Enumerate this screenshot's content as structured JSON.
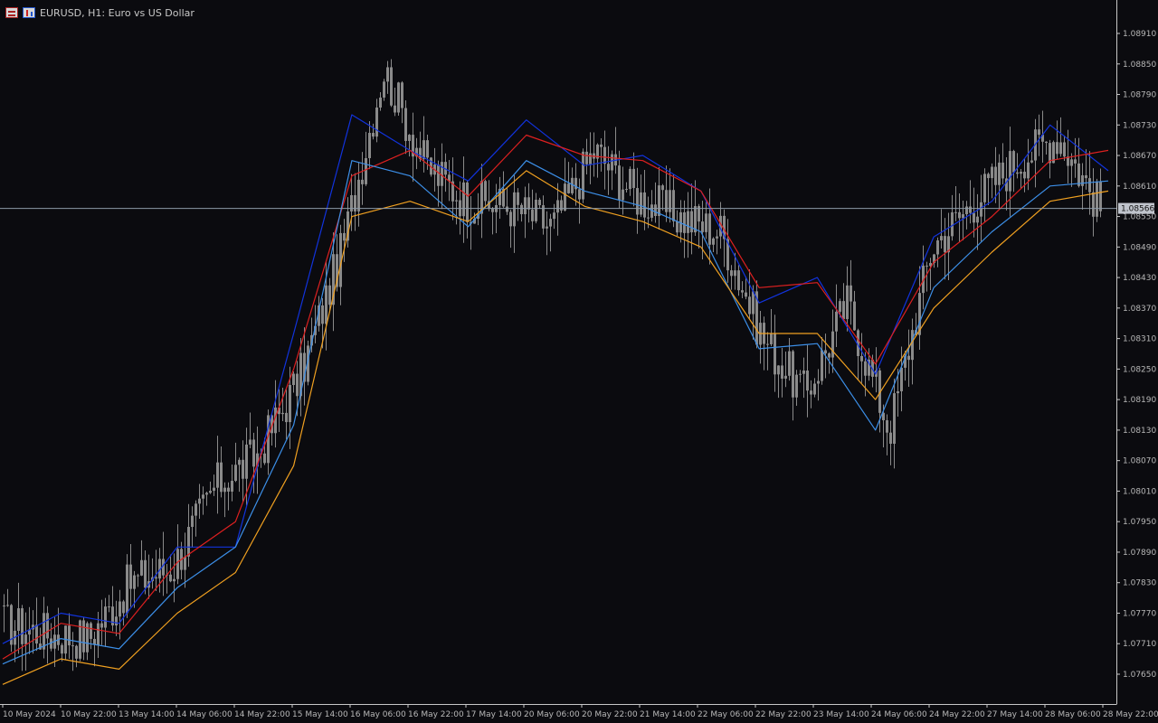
{
  "header": {
    "title": "EURUSD, H1:  Euro vs US Dollar",
    "icons": [
      "chart-list-icon",
      "one-click-trading-icon"
    ]
  },
  "colors": {
    "background": "#0b0b0f",
    "axis": "#c8c8c8",
    "candle": "#8a8a8a",
    "bid_line": "#8d9aa8",
    "ma_blue": "#1133dd",
    "ma_red": "#dd2020",
    "ma_lightblue": "#3c8fe8",
    "ma_orange": "#f0a020"
  },
  "price_axis": {
    "labels": [
      "1.08910",
      "1.08850",
      "1.08790",
      "1.08730",
      "1.08670",
      "1.08610",
      "1.08550",
      "1.08490",
      "1.08430",
      "1.08370",
      "1.08310",
      "1.08250",
      "1.08190",
      "1.08130",
      "1.08070",
      "1.08010",
      "1.07950",
      "1.07890",
      "1.07830",
      "1.07770",
      "1.07710",
      "1.07650"
    ],
    "current_bid": "1.08566"
  },
  "time_axis": {
    "labels": [
      "10 May 2024",
      "10 May 22:00",
      "13 May 14:00",
      "14 May 06:00",
      "14 May 22:00",
      "15 May 14:00",
      "16 May 06:00",
      "16 May 22:00",
      "17 May 14:00",
      "20 May 06:00",
      "20 May 22:00",
      "21 May 14:00",
      "22 May 06:00",
      "22 May 22:00",
      "23 May 14:00",
      "24 May 06:00",
      "24 May 22:00",
      "27 May 14:00",
      "28 May 06:00",
      "28 May 22:00"
    ]
  },
  "chart_data": {
    "type": "line",
    "symbol": "EURUSD",
    "timeframe": "H1",
    "ylim": [
      1.0761,
      1.0895
    ],
    "price_ticks": [
      1.0891,
      1.0885,
      1.0879,
      1.0873,
      1.0867,
      1.0861,
      1.0855,
      1.0849,
      1.0843,
      1.0837,
      1.0831,
      1.0825,
      1.0819,
      1.0813,
      1.0807,
      1.0801,
      1.0795,
      1.0789,
      1.0783,
      1.0777,
      1.0771,
      1.0765
    ],
    "x": [
      "10 May 2024",
      "10 May 22:00",
      "13 May 14:00",
      "14 May 06:00",
      "14 May 22:00",
      "15 May 14:00",
      "16 May 06:00",
      "16 May 22:00",
      "17 May 14:00",
      "20 May 06:00",
      "20 May 22:00",
      "21 May 14:00",
      "22 May 06:00",
      "22 May 22:00",
      "23 May 14:00",
      "24 May 06:00",
      "24 May 22:00",
      "27 May 14:00",
      "28 May 06:00",
      "28 May 22:00"
    ],
    "close_path": [
      1.0775,
      1.0773,
      1.0772,
      1.0783,
      1.0786,
      1.0802,
      1.0808,
      1.0823,
      1.0848,
      1.0884,
      1.0865,
      1.0858,
      1.0857,
      1.0853,
      1.0868,
      1.0859,
      1.0855,
      1.0852,
      1.0831,
      1.082,
      1.0838,
      1.0813,
      1.0849,
      1.0858,
      1.0866,
      1.0871,
      1.08566
    ],
    "series": [
      {
        "color": "#1133dd",
        "values": [
          1.0771,
          1.0777,
          1.0775,
          1.079,
          1.079,
          1.0832,
          1.0875,
          1.0868,
          1.0862,
          1.0874,
          1.0865,
          1.0867,
          1.086,
          1.0838,
          1.0843,
          1.0824,
          1.0851,
          1.0858,
          1.0873,
          1.0864
        ]
      },
      {
        "color": "#dd2020",
        "values": [
          1.0768,
          1.0775,
          1.0773,
          1.0787,
          1.0795,
          1.0825,
          1.0863,
          1.0868,
          1.0859,
          1.0871,
          1.0867,
          1.0866,
          1.086,
          1.0841,
          1.0842,
          1.0826,
          1.0846,
          1.0855,
          1.0866,
          1.0868
        ]
      },
      {
        "color": "#3c8fe8",
        "values": [
          1.0767,
          1.0772,
          1.077,
          1.0782,
          1.079,
          1.0814,
          1.0866,
          1.0863,
          1.0853,
          1.0866,
          1.086,
          1.0857,
          1.0852,
          1.0829,
          1.083,
          1.0813,
          1.0841,
          1.0852,
          1.0861,
          1.0862
        ]
      },
      {
        "color": "#f0a020",
        "values": [
          1.0763,
          1.0768,
          1.0766,
          1.0777,
          1.0785,
          1.0806,
          1.0855,
          1.0858,
          1.0854,
          1.0864,
          1.0857,
          1.0854,
          1.0849,
          1.0832,
          1.0832,
          1.0819,
          1.0837,
          1.0848,
          1.0858,
          1.086
        ]
      }
    ]
  }
}
